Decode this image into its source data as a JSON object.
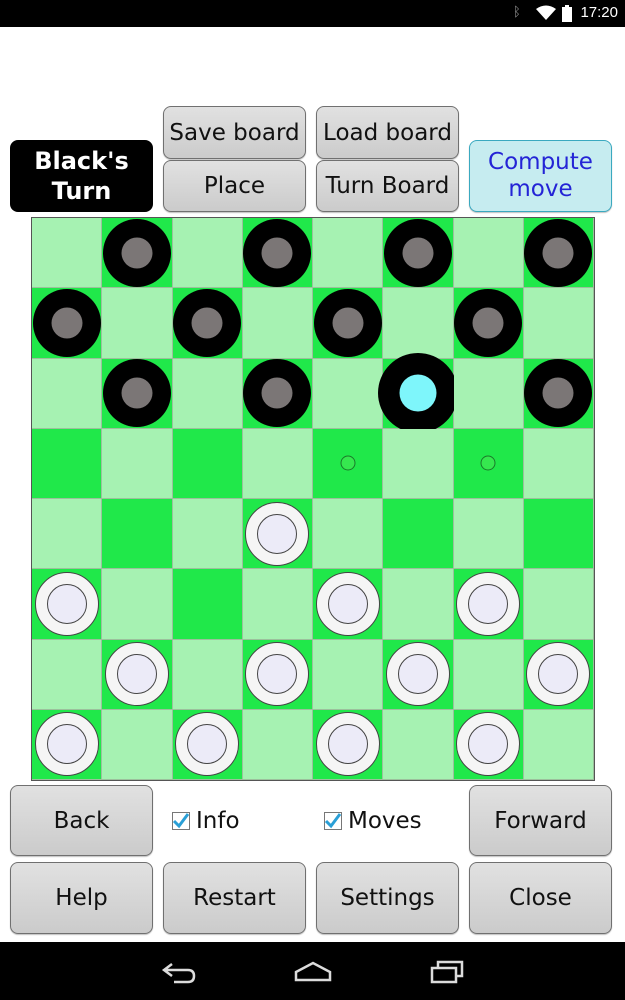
{
  "status_bar": {
    "time": "17:20"
  },
  "top_buttons": {
    "save": "Save board",
    "load": "Load board",
    "place": "Place",
    "turn_board": "Turn Board",
    "compute": "Compute\nmove"
  },
  "turn_indicator": "Black's\nTurn",
  "bottom": {
    "back": "Back",
    "info": "Info",
    "info_checked": true,
    "moves": "Moves",
    "moves_checked": true,
    "forward": "Forward",
    "help": "Help",
    "restart": "Restart",
    "settings": "Settings",
    "close": "Close"
  },
  "board": {
    "rows": [
      [
        "",
        "b",
        "",
        "b",
        "",
        "b",
        "",
        "b"
      ],
      [
        "b",
        "",
        "b",
        "",
        "b",
        "",
        "b",
        ""
      ],
      [
        "",
        "b",
        "",
        "b",
        "",
        "bs",
        "",
        "b"
      ],
      [
        "",
        "",
        "",
        "",
        "h",
        "",
        "h",
        ""
      ],
      [
        "",
        "",
        "",
        "w",
        "",
        "",
        "",
        ""
      ],
      [
        "w",
        "",
        "",
        "",
        "w",
        "",
        "w",
        ""
      ],
      [
        "",
        "w",
        "",
        "w",
        "",
        "w",
        "",
        "w"
      ],
      [
        "w",
        "",
        "w",
        "",
        "w",
        "",
        "w",
        ""
      ]
    ],
    "legend": {
      "b": "black-piece",
      "bs": "selected-black-piece",
      "w": "white-piece",
      "h": "move-hint"
    },
    "colors": {
      "light": "#a6f2b2",
      "dark": "#20e84a"
    }
  },
  "icons": {
    "status": [
      "bluetooth-icon",
      "wifi-icon",
      "battery-icon"
    ],
    "nav": [
      "back-nav-icon",
      "home-nav-icon",
      "recents-nav-icon"
    ]
  }
}
